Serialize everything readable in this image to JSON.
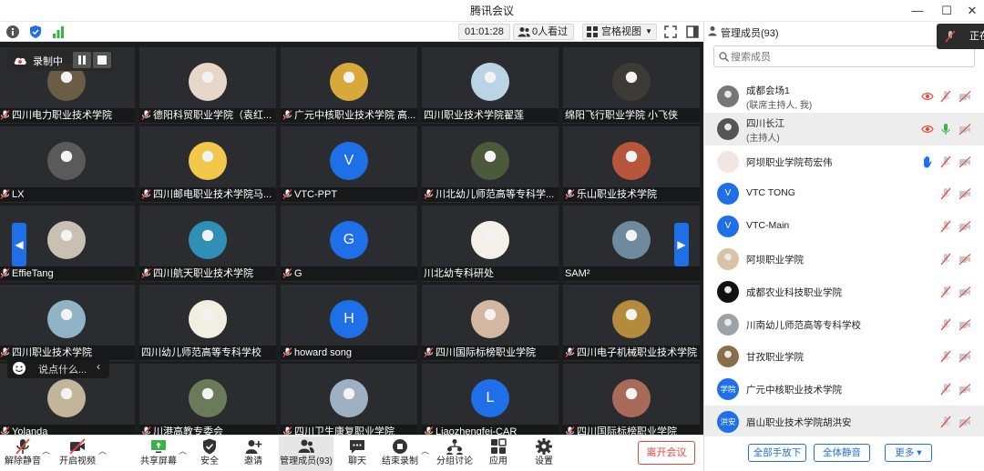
{
  "window": {
    "title": "腾讯会议",
    "minimize": "—",
    "maximize": "☐",
    "close": "✕"
  },
  "meeting_bar": {
    "duration": "01:01:28",
    "viewers": "0人看过",
    "view_mode": "宫格视图"
  },
  "recording": {
    "label": "录制中"
  },
  "chat_prompt": {
    "placeholder": "说点什么..."
  },
  "tiles": [
    {
      "name": "四川电力职业技术学院",
      "avatar": "photo",
      "color": "#6b5c45",
      "mic": "muted"
    },
    {
      "name": "德阳科贸职业学院（袁红...",
      "avatar": "photo",
      "color": "#e8d6c8",
      "mic": "muted"
    },
    {
      "name": "广元中核职业技术学院 高...",
      "avatar": "photo",
      "color": "#d9a83a",
      "mic": "muted"
    },
    {
      "name": "四川职业技术学院翟莲",
      "avatar": "photo",
      "color": "#bcd3e6",
      "mic": "none"
    },
    {
      "name": "绵阳飞行职业学院 小飞侠",
      "avatar": "photo",
      "color": "#3d3b36",
      "mic": "none"
    },
    {
      "name": "LX",
      "avatar": "photo",
      "color": "#5a5a5a",
      "mic": "muted"
    },
    {
      "name": "四川邮电职业技术学院马...",
      "avatar": "photo",
      "color": "#f2c84b",
      "mic": "muted"
    },
    {
      "name": "VTC-PPT",
      "avatar": "letter",
      "letter": "V",
      "mic": "muted"
    },
    {
      "name": "川北幼儿师范高等专科学...",
      "avatar": "photo",
      "color": "#4b5a3a",
      "mic": "muted"
    },
    {
      "name": "乐山职业技术学院",
      "avatar": "photo",
      "color": "#b8563c",
      "mic": "muted"
    },
    {
      "name": "EffieTang",
      "avatar": "photo",
      "color": "#c9bfb3",
      "mic": "muted"
    },
    {
      "name": "四川航天职业技术学院",
      "avatar": "photo",
      "color": "#2f8fb5",
      "mic": "muted"
    },
    {
      "name": "G",
      "avatar": "letter",
      "letter": "G",
      "mic": "muted"
    },
    {
      "name": "川北幼专科研处",
      "avatar": "photo",
      "color": "#f4efe8",
      "mic": "none"
    },
    {
      "name": "SAM²",
      "avatar": "photo",
      "color": "#6f8a9e",
      "mic": "none"
    },
    {
      "name": "四川职业技术学院",
      "avatar": "photo",
      "color": "#8fb4c8",
      "mic": "muted"
    },
    {
      "name": "四川幼儿师范高等专科学校",
      "avatar": "photo",
      "color": "#f3eee2",
      "mic": "none"
    },
    {
      "name": "howard song",
      "avatar": "letter",
      "letter": "H",
      "mic": "muted"
    },
    {
      "name": "四川国际标榜职业学院",
      "avatar": "photo",
      "color": "#d3b7a1",
      "mic": "muted"
    },
    {
      "name": "四川电子机械职业技术学院",
      "avatar": "photo",
      "color": "#b48a3c",
      "mic": "muted"
    },
    {
      "name": "Yolanda",
      "avatar": "photo",
      "color": "#c2b59a",
      "mic": "muted"
    },
    {
      "name": "川港高教专委会",
      "avatar": "photo",
      "color": "#6b7b5a",
      "mic": "muted"
    },
    {
      "name": "四川卫生康复职业学院",
      "avatar": "photo",
      "color": "#9fb0c2",
      "mic": "muted"
    },
    {
      "name": "Liaozhengfei-CAR",
      "avatar": "letter",
      "letter": "L",
      "mic": "muted"
    },
    {
      "name": "四川国际标榜职业学院",
      "avatar": "photo",
      "color": "#a86b5a",
      "mic": "muted"
    }
  ],
  "toolbar": {
    "unmute": "解除静音",
    "start_video": "开启视频",
    "share": "共享屏幕",
    "security": "安全",
    "invite": "邀请",
    "members": "管理成员(93)",
    "chat": "聊天",
    "end_record": "结束录制",
    "breakout": "分组讨论",
    "apps": "应用",
    "settings": "设置",
    "leave": "离开会议"
  },
  "panel": {
    "title": "管理成员(93)",
    "search_placeholder": "搜索成员",
    "speaking": "正在",
    "members": [
      {
        "name": "成都会场1",
        "sub": "(联席主持人, 我)",
        "avatar": "photo",
        "color": "#777",
        "eye": true,
        "mic": "muted",
        "cam": "off"
      },
      {
        "name": "四川长江",
        "sub": "(主持人)",
        "avatar": "photo",
        "color": "#555",
        "eye": true,
        "mic": "on",
        "cam": "off",
        "selected": true
      },
      {
        "name": "阿坝职业学院苟宏伟",
        "sub": "",
        "avatar": "photo",
        "color": "#f2e6e0",
        "hand": true,
        "mic": "muted",
        "cam": "off"
      },
      {
        "name": "VTC TONG",
        "sub": "",
        "avatar": "letter",
        "letter": "V",
        "mic": "muted",
        "cam": "off"
      },
      {
        "name": "VTC-Main",
        "sub": "",
        "avatar": "letter",
        "letter": "V",
        "mic": "muted",
        "cam": "off"
      },
      {
        "name": "阿坝职业学院",
        "sub": "",
        "avatar": "photo",
        "color": "#d8c3a5",
        "mic": "muted",
        "cam": "off"
      },
      {
        "name": "成都农业科技职业学院",
        "sub": "",
        "avatar": "photo",
        "color": "#111",
        "mic": "muted",
        "cam": "off"
      },
      {
        "name": "川南幼儿师范高等专科学校",
        "sub": "",
        "avatar": "photo",
        "color": "#9aa3a8",
        "mic": "muted",
        "cam": "off"
      },
      {
        "name": "甘孜职业学院",
        "sub": "",
        "avatar": "photo",
        "color": "#8a6e4a",
        "mic": "muted",
        "cam": "off"
      },
      {
        "name": "广元中核职业技术学院",
        "sub": "",
        "avatar": "letter",
        "letter": "学院",
        "mic": "muted",
        "cam": "off"
      },
      {
        "name": "眉山职业技术学院胡洪安",
        "sub": "",
        "avatar": "letter",
        "letter": "洪安",
        "mic": "muted",
        "cam": "off",
        "selected": true
      }
    ],
    "mute_hands": "全部手放下",
    "mute_all": "全体静音",
    "more": "更多 ▾"
  },
  "colors": {
    "accent": "#1f6fe8",
    "danger": "#e8453c",
    "mic_on": "#3cb34a"
  }
}
